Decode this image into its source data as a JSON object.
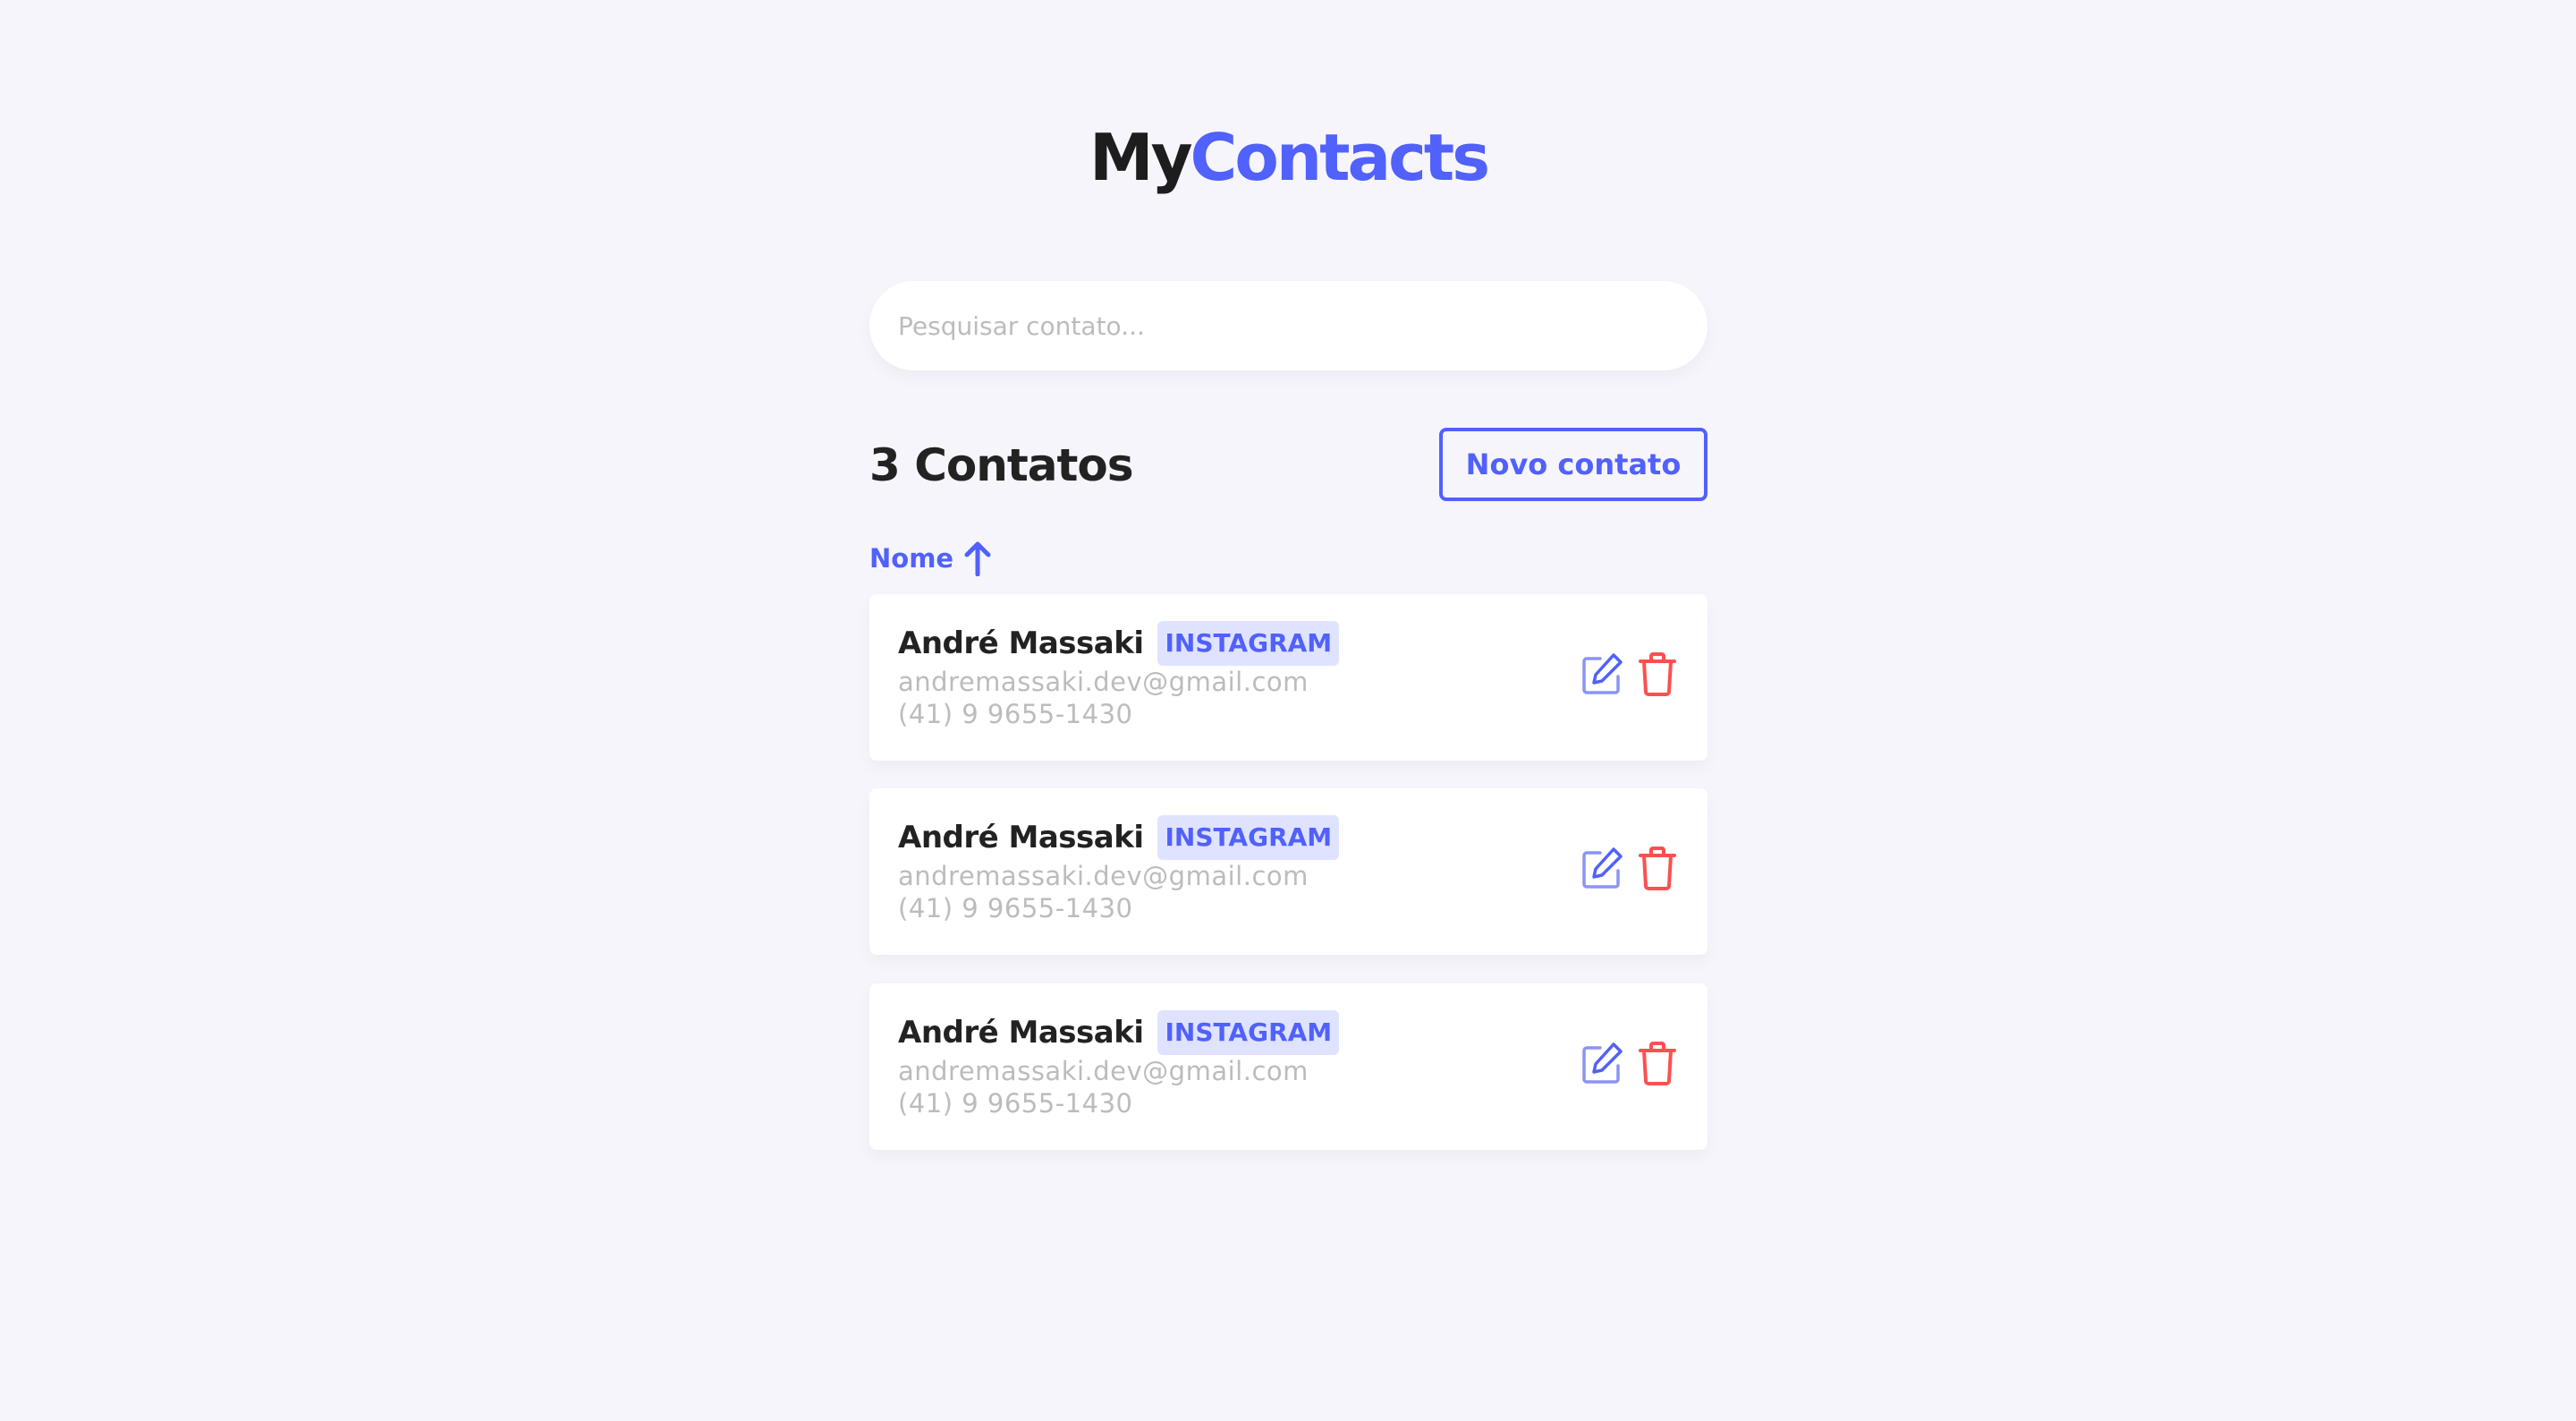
{
  "header": {
    "logo_part1": "My",
    "logo_part2": "Contacts"
  },
  "search": {
    "placeholder": "Pesquisar contato...",
    "value": ""
  },
  "list_header": {
    "count_title": "3 Contatos",
    "new_button_label": "Novo contato"
  },
  "sort": {
    "label": "Nome",
    "direction": "ascending",
    "icon": "arrow-up-icon"
  },
  "contacts": [
    {
      "name": "André Massaki",
      "category": "INSTAGRAM",
      "email": "andremassaki.dev@gmail.com",
      "phone": "(41) 9 9655-1430"
    },
    {
      "name": "André Massaki",
      "category": "INSTAGRAM",
      "email": "andremassaki.dev@gmail.com",
      "phone": "(41) 9 9655-1430"
    },
    {
      "name": "André Massaki",
      "category": "INSTAGRAM",
      "email": "andremassaki.dev@gmail.com",
      "phone": "(41) 9 9655-1430"
    }
  ],
  "icons": {
    "edit": "edit-icon",
    "delete": "trash-icon"
  },
  "colors": {
    "background": "#f6f5fc",
    "primary": "#5061fc",
    "badge_bg": "#e0e3ff",
    "danger": "#fc5050",
    "text": "#222222",
    "muted": "#bcbcbc"
  }
}
